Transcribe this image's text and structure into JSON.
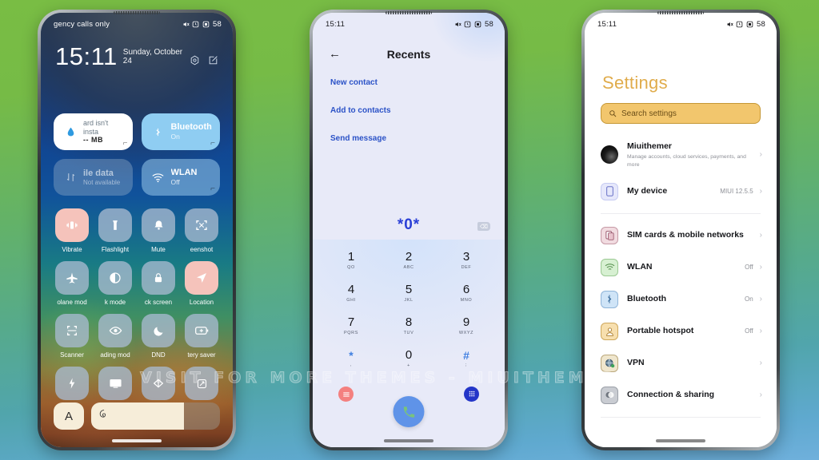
{
  "watermark": "VISIT FOR MORE THEMES - MIUITHEMER.COM",
  "background": {
    "top_color": "#79bd44",
    "bottom_color": "#6fb0dc"
  },
  "status_bar": {
    "time": "15:11",
    "battery": "58",
    "icons": [
      "mute-icon",
      "alarm-icon",
      "dnd-icon"
    ]
  },
  "phone1": {
    "name": "Control Center",
    "carrier": "gency calls only",
    "time": "15:11",
    "date": "Sunday, October 24",
    "header_icons": [
      "settings-hex-icon",
      "edit-square-icon"
    ],
    "big_tiles": [
      {
        "title": "ard isn't insta",
        "sub": "-- MB",
        "icon": "water-drop-icon",
        "style": "white"
      },
      {
        "title": "Bluetooth",
        "sub": "On",
        "icon": "bluetooth-icon",
        "style": "blue"
      },
      {
        "title": "ile data",
        "sub": "Not available",
        "icon": "mobile-data-icon",
        "style": "dim"
      },
      {
        "title": "WLAN",
        "sub": "Off",
        "icon": "wifi-icon",
        "style": "dim2"
      }
    ],
    "toggles": [
      {
        "label": "Vibrate",
        "icon": "vibrate-icon",
        "accent": true
      },
      {
        "label": "Flashlight",
        "icon": "flashlight-icon",
        "accent": false
      },
      {
        "label": "Mute",
        "icon": "bell-icon",
        "accent": false
      },
      {
        "label": "eenshot",
        "icon": "screenshot-icon",
        "accent": false
      },
      {
        "label": "olane mod",
        "icon": "airplane-icon",
        "accent": false
      },
      {
        "label": "k mode",
        "icon": "dark-mode-icon",
        "accent": false
      },
      {
        "label": "ck screen",
        "icon": "lock-icon",
        "accent": false
      },
      {
        "label": "Location",
        "icon": "location-icon",
        "accent": true
      },
      {
        "label": "Scanner",
        "icon": "scanner-icon",
        "accent": false
      },
      {
        "label": "ading mod",
        "icon": "reading-mode-icon",
        "accent": false
      },
      {
        "label": "DND",
        "icon": "moon-icon",
        "accent": false
      },
      {
        "label": "tery saver",
        "icon": "battery-saver-icon",
        "accent": false
      },
      {
        "label": "",
        "icon": "flash-icon",
        "accent": false
      },
      {
        "label": "",
        "icon": "cast-icon",
        "accent": false
      },
      {
        "label": "",
        "icon": "data-saver-icon",
        "accent": false
      },
      {
        "label": "",
        "icon": "rotate-icon",
        "accent": false
      }
    ],
    "brightness": {
      "auto_label": "A",
      "icon": "brightness-spiral-icon",
      "level_percent": 72
    }
  },
  "phone2": {
    "name": "Dialer",
    "title": "Recents",
    "back_icon": "back-arrow-icon",
    "actions": [
      "New contact",
      "Add to contacts",
      "Send message"
    ],
    "dialed_number": "*0*",
    "delete_icon": "backspace-icon",
    "keypad": [
      {
        "digit": "1",
        "letters": "QO"
      },
      {
        "digit": "2",
        "letters": "ABC"
      },
      {
        "digit": "3",
        "letters": "DEF"
      },
      {
        "digit": "4",
        "letters": "GHI"
      },
      {
        "digit": "5",
        "letters": "JKL"
      },
      {
        "digit": "6",
        "letters": "MNO"
      },
      {
        "digit": "7",
        "letters": "PQRS"
      },
      {
        "digit": "8",
        "letters": "TUV"
      },
      {
        "digit": "9",
        "letters": "WXYZ"
      },
      {
        "digit": "*",
        "letters": ","
      },
      {
        "digit": "0",
        "letters": "+"
      },
      {
        "digit": "#",
        "letters": ";"
      }
    ],
    "bottom": {
      "left_icon": "menu-icon",
      "call_icon": "call-icon",
      "right_icon": "keypad-icon"
    }
  },
  "phone3": {
    "name": "Settings",
    "title": "Settings",
    "search_placeholder": "Search settings",
    "search_icon": "search-icon",
    "items": [
      {
        "label": "Miuithemer",
        "desc": "Manage accounts, cloud services, payments, and more",
        "value": "",
        "icon": "avatar"
      },
      {
        "label": "My device",
        "desc": "",
        "value": "MIUI 12.5.5",
        "icon": "device-icon"
      },
      {
        "label": "SIM cards & mobile networks",
        "desc": "",
        "value": "",
        "icon": "sim-icon"
      },
      {
        "label": "WLAN",
        "desc": "",
        "value": "Off",
        "icon": "wifi-icon"
      },
      {
        "label": "Bluetooth",
        "desc": "",
        "value": "On",
        "icon": "bluetooth-icon"
      },
      {
        "label": "Portable hotspot",
        "desc": "",
        "value": "Off",
        "icon": "hotspot-icon"
      },
      {
        "label": "VPN",
        "desc": "",
        "value": "",
        "icon": "vpn-icon"
      },
      {
        "label": "Connection & sharing",
        "desc": "",
        "value": "",
        "icon": "connection-icon"
      }
    ]
  }
}
